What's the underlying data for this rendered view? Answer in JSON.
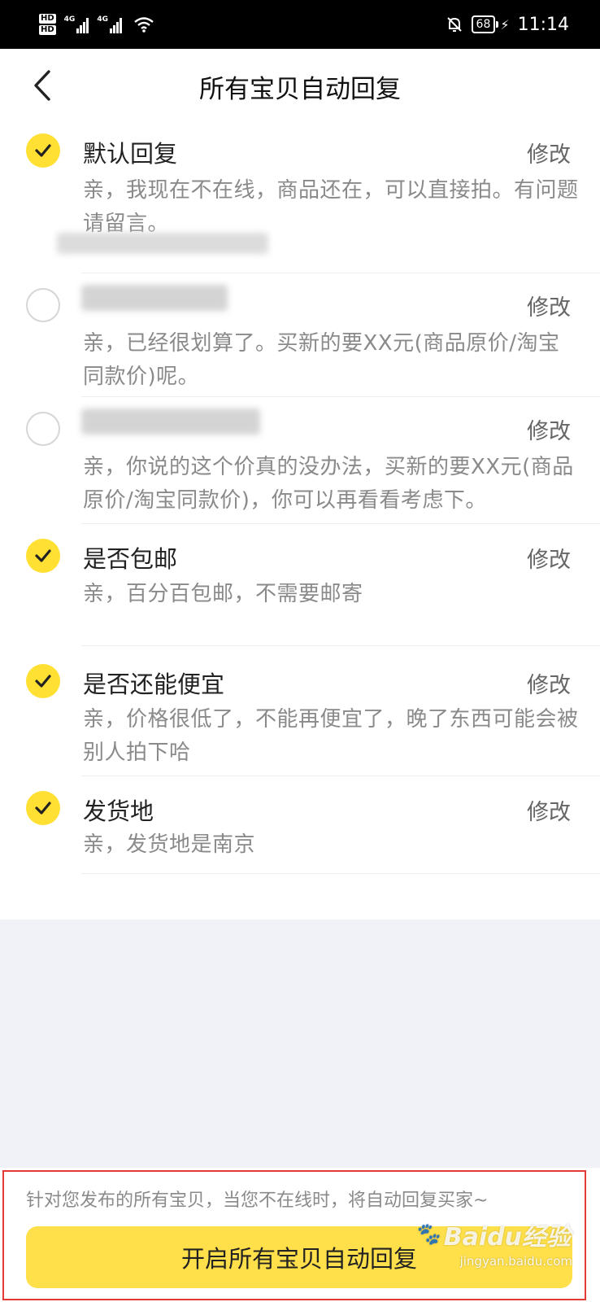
{
  "status_bar": {
    "hd1": "HD",
    "hd2": "HD",
    "net1": "4G",
    "net2": "4G",
    "battery": "68",
    "time": "11:14",
    "icons": [
      "hd-icon",
      "signal-icon",
      "wifi-icon",
      "mute-bell-icon",
      "battery-icon",
      "charging-icon"
    ]
  },
  "header": {
    "title": "所有宝贝自动回复",
    "back_icon": "back-chevron-icon"
  },
  "items": [
    {
      "checked": true,
      "title": "默认回复",
      "edit": "修改",
      "desc": "亲，我现在不在线，商品还在，可以直接拍。有问题请留言。"
    },
    {
      "checked": false,
      "title": "",
      "edit": "修改",
      "desc": "亲，已经很划算了。买新的要XX元(商品原价/淘宝同款价)呢。"
    },
    {
      "checked": false,
      "title": "",
      "edit": "修改",
      "desc": "亲，你说的这个价真的没办法，买新的要XX元(商品原价/淘宝同款价)，你可以再看看考虑下。"
    },
    {
      "checked": true,
      "title": "是否包邮",
      "edit": "修改",
      "desc": "亲，百分百包邮，不需要邮寄"
    },
    {
      "checked": true,
      "title": "是否还能便宜",
      "edit": "修改",
      "desc": "亲，价格很低了，不能再便宜了，晚了东西可能会被别人拍下哈"
    },
    {
      "checked": true,
      "title": "发货地",
      "edit": "修改",
      "desc": "亲，发货地是南京"
    }
  ],
  "footer": {
    "hint": "针对您发布的所有宝贝，当您不在线时，将自动回复买家~",
    "button": "开启所有宝贝自动回复"
  },
  "watermark": {
    "brand": "Baidu经验",
    "site": "jingyan.baidu.com"
  },
  "colors": {
    "accent": "#ffe033",
    "button": "#ffe04a",
    "highlight_frame": "#e53935",
    "page_bg": "#f1f2f7"
  }
}
